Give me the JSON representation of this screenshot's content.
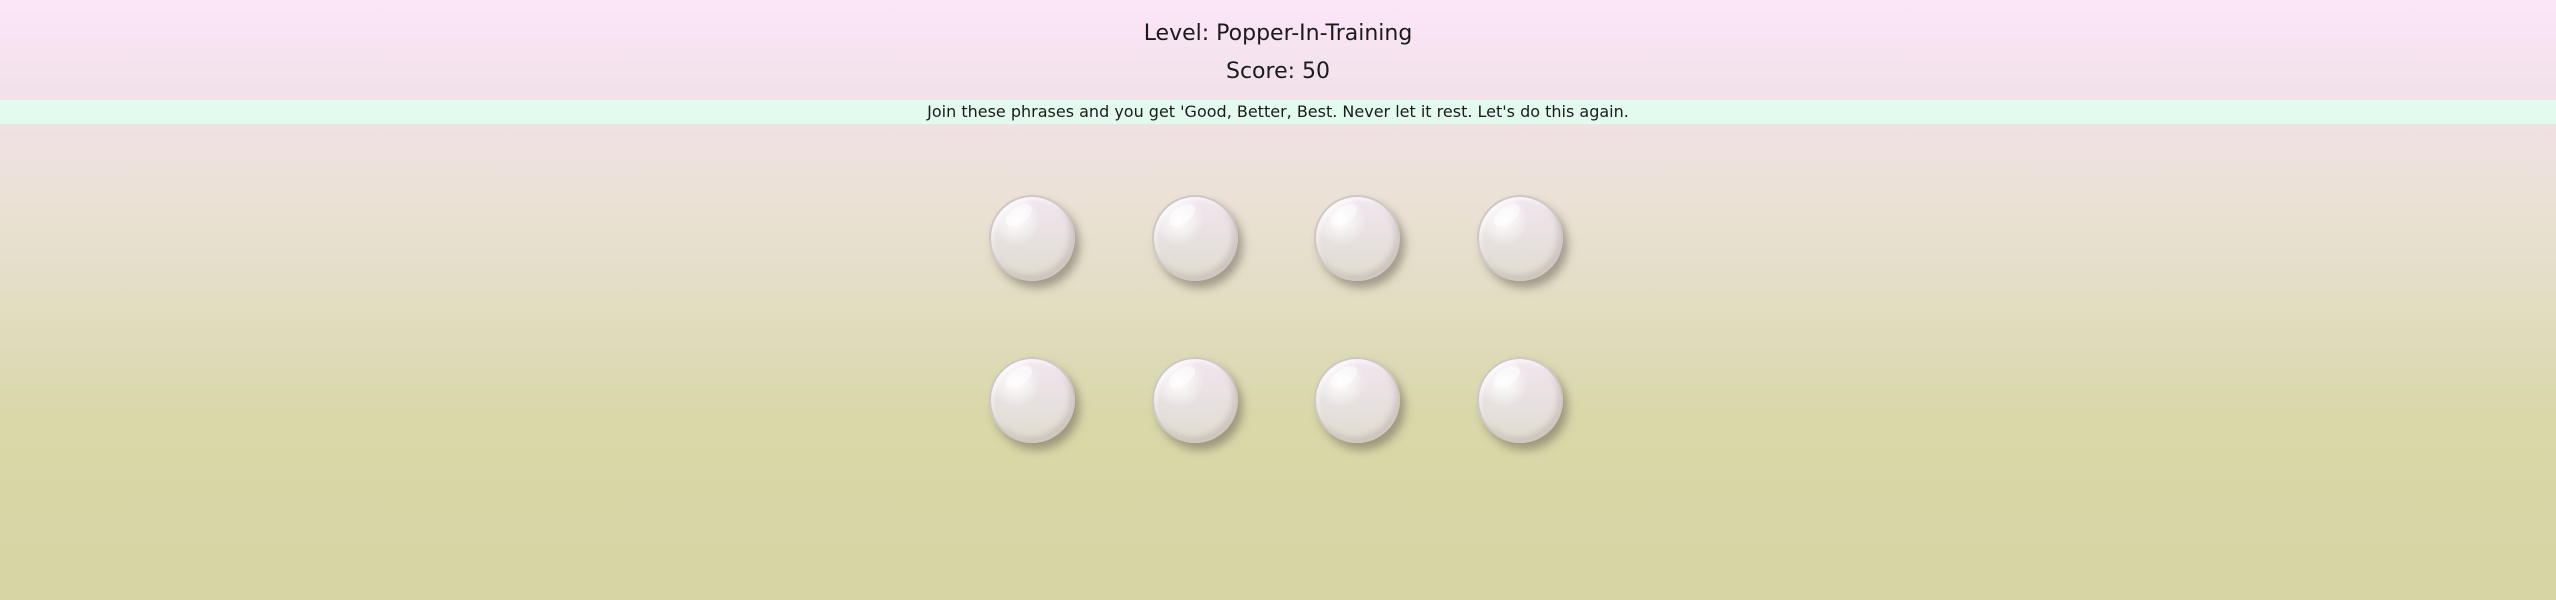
{
  "game": {
    "level_text": "Level: Popper-In-Training",
    "score_text": "Score: 50",
    "message": "Join these phrases and you get 'Good, Better, Best. Never let it rest. Let's do this again."
  },
  "grid": {
    "rows": 2,
    "columns": 4,
    "bubble_count": 8
  },
  "colors": {
    "message_bar": "#e3fbee",
    "bubble_border": "#cfc7c4"
  }
}
